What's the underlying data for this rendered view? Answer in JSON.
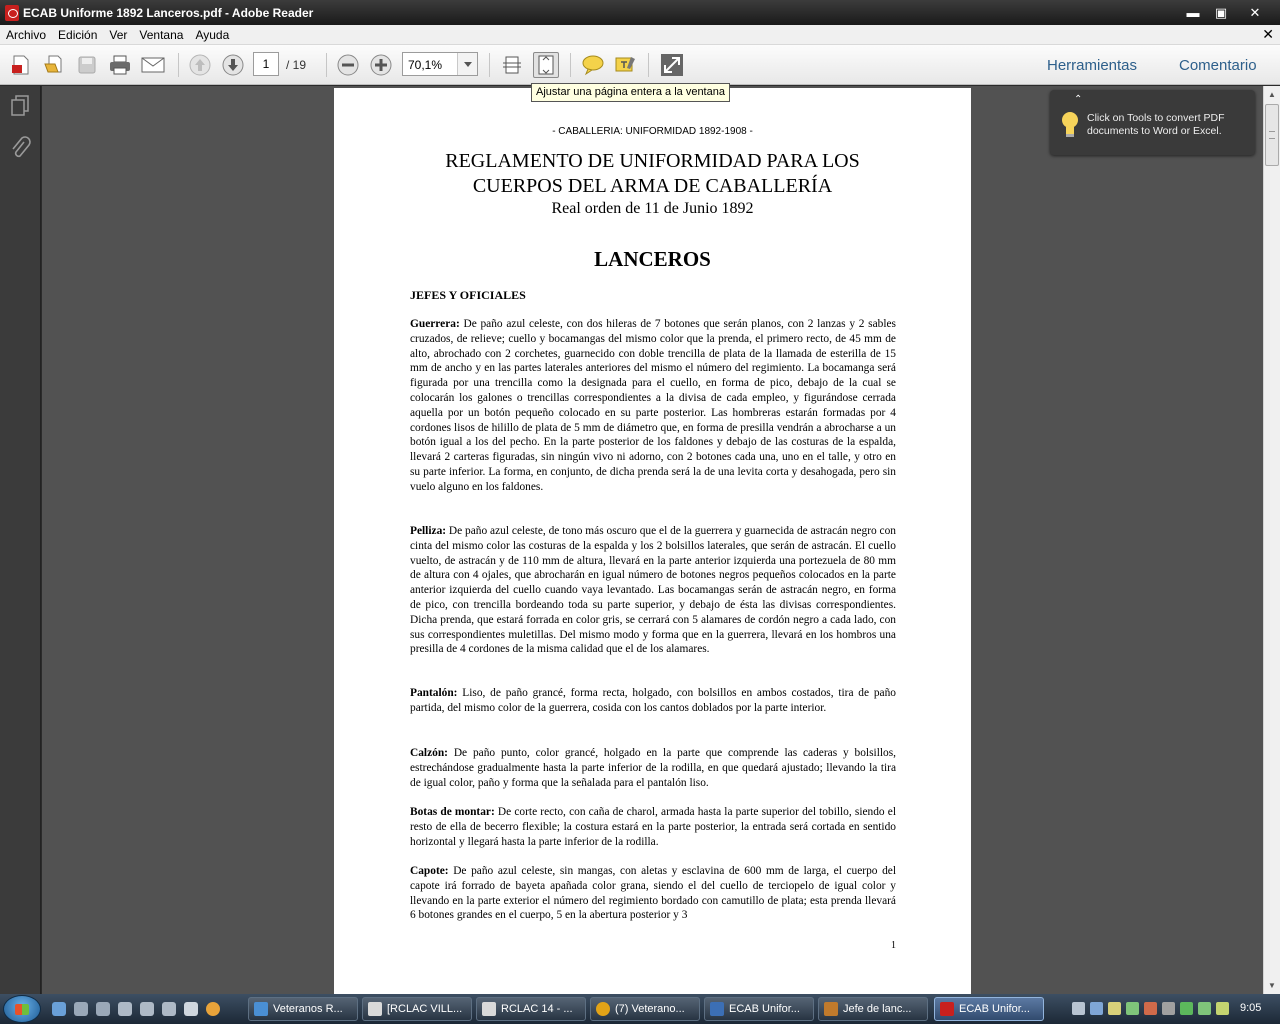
{
  "window": {
    "title": "ECAB Uniforme 1892 Lanceros.pdf - Adobe Reader",
    "min": "▬",
    "max": "▣",
    "close": "✕"
  },
  "menu": {
    "items": [
      "Archivo",
      "Edición",
      "Ver",
      "Ventana",
      "Ayuda"
    ],
    "close": "✕"
  },
  "toolbar": {
    "page_current": "1",
    "page_total": "/ 19",
    "zoom": "70,1%",
    "tools_label": "Herramientas",
    "comment_label": "Comentario",
    "tooltip": "Ajustar una página entera a la ventana"
  },
  "callout": {
    "caret": "⌃",
    "text": "Click on Tools to convert PDF documents to Word or Excel."
  },
  "document": {
    "header": "- CABALLERIA: UNIFORMIDAD 1892-1908 -",
    "title_line1": "REGLAMENTO DE UNIFORMIDAD PARA LOS",
    "title_line2": "CUERPOS DEL ARMA DE CABALLERÍA",
    "subtitle": "Real orden de 11 de Junio 1892",
    "section": "LANCEROS",
    "subsection": "JEFES Y OFICIALES",
    "paragraphs": [
      {
        "term": "Guerrera:",
        "text": " De paño azul celeste, con dos hileras de 7 botones que serán planos, con 2 lanzas y 2 sables cruzados, de relieve; cuello y bocamangas del mismo color que la prenda, el primero recto, de 45 mm de alto, abrochado con 2 corchetes, guarnecido con doble trencilla de plata de la llamada de esterilla de 15 mm de ancho y en las partes laterales anteriores del mismo el número del regimiento. La bocamanga será figurada por una trencilla como la designada para el cuello, en forma de pico, debajo de la cual se colocarán los galones o trencillas correspondientes a la divisa de cada empleo, y figurándose cerrada aquella por un botón pequeño colocado en su parte posterior. Las hombreras estarán formadas por 4 cordones lisos de hilillo de plata de 5 mm de diámetro que, en forma de presilla vendrán a abrocharse a un botón igual a los del pecho. En la parte posterior de los faldones y debajo de las costuras de la espalda, llevará 2 carteras figuradas, sin ningún vivo ni adorno, con 2 botones cada una, uno en el talle, y otro en su parte inferior. La forma, en conjunto, de dicha prenda será la de una levita corta y desahogada, pero sin vuelo alguno en los faldones."
      },
      {
        "term": "Pelliza:",
        "text": " De paño azul celeste, de tono más oscuro que el de la guerrera y guarnecida de astracán negro con cinta del mismo color las costuras de la espalda y los 2 bolsillos laterales, que serán de astracán. El cuello vuelto, de astracán y de 110 mm de altura, llevará en la parte anterior izquierda una portezuela de 80 mm de altura con 4 ojales, que abrocharán en igual número de botones negros pequeños colocados en la parte anterior izquierda del cuello cuando vaya levantado. Las bocamangas serán de astracán negro, en forma de pico, con trencilla bordeando toda su parte superior, y debajo de ésta las divisas correspondientes. Dicha prenda, que estará forrada en color gris, se cerrará con 5 alamares de cordón negro a cada lado, con sus correspondientes muletillas. Del mismo modo y forma que en la guerrera, llevará en los hombros una presilla de 4 cordones de la misma calidad que el de los alamares."
      },
      {
        "term": "Pantalón:",
        "text": " Liso, de paño grancé, forma recta, holgado, con bolsillos en ambos costados, tira de paño partida, del mismo color de la guerrera, cosida con los cantos doblados por la parte interior."
      },
      {
        "term": "Calzón:",
        "text": " De paño punto, color grancé, holgado en la parte que comprende las caderas y bolsillos, estrechándose gradualmente hasta la parte inferior de la rodilla, en que quedará ajustado; llevando la tira de igual color, paño y forma que la señalada para el pantalón liso."
      },
      {
        "term": "Botas de montar:",
        "text": " De corte recto, con caña de charol, armada hasta la parte superior del tobillo, siendo el resto de ella de becerro flexible; la costura estará en la parte posterior, la entrada será cortada en sentido horizontal y llegará hasta la parte inferior de la rodilla."
      },
      {
        "term": "Capote:",
        "text": " De paño azul celeste, sin mangas, con aletas y esclavina de 600 mm de larga, el cuerpo del capote irá forrado de bayeta apañada color grana, siendo el del cuello de terciopelo de igual color y llevando en la parte exterior el número del regimiento bordado con camutillo de plata; esta prenda llevará 6 botones grandes en el cuerpo, 5 en la abertura posterior y 3"
      }
    ],
    "page_number": "1"
  },
  "taskbar": {
    "tasks": [
      {
        "label": "Veteranos R...",
        "icon_color": "#4a8fd4"
      },
      {
        "label": "[RCLAC VILL...",
        "icon_color": "#d9d9d9"
      },
      {
        "label": "RCLAC 14 - ...",
        "icon_color": "#d9d9d9"
      },
      {
        "label": "(7) Veterano...",
        "icon_color": "#e2a317"
      },
      {
        "label": "ECAB Unifor...",
        "icon_color": "#3c6fb5"
      },
      {
        "label": "Jefe de lanc...",
        "icon_color": "#c07a2c"
      },
      {
        "label": "ECAB Unifor...",
        "icon_color": "#c8201e"
      }
    ],
    "clock": "9:05"
  }
}
